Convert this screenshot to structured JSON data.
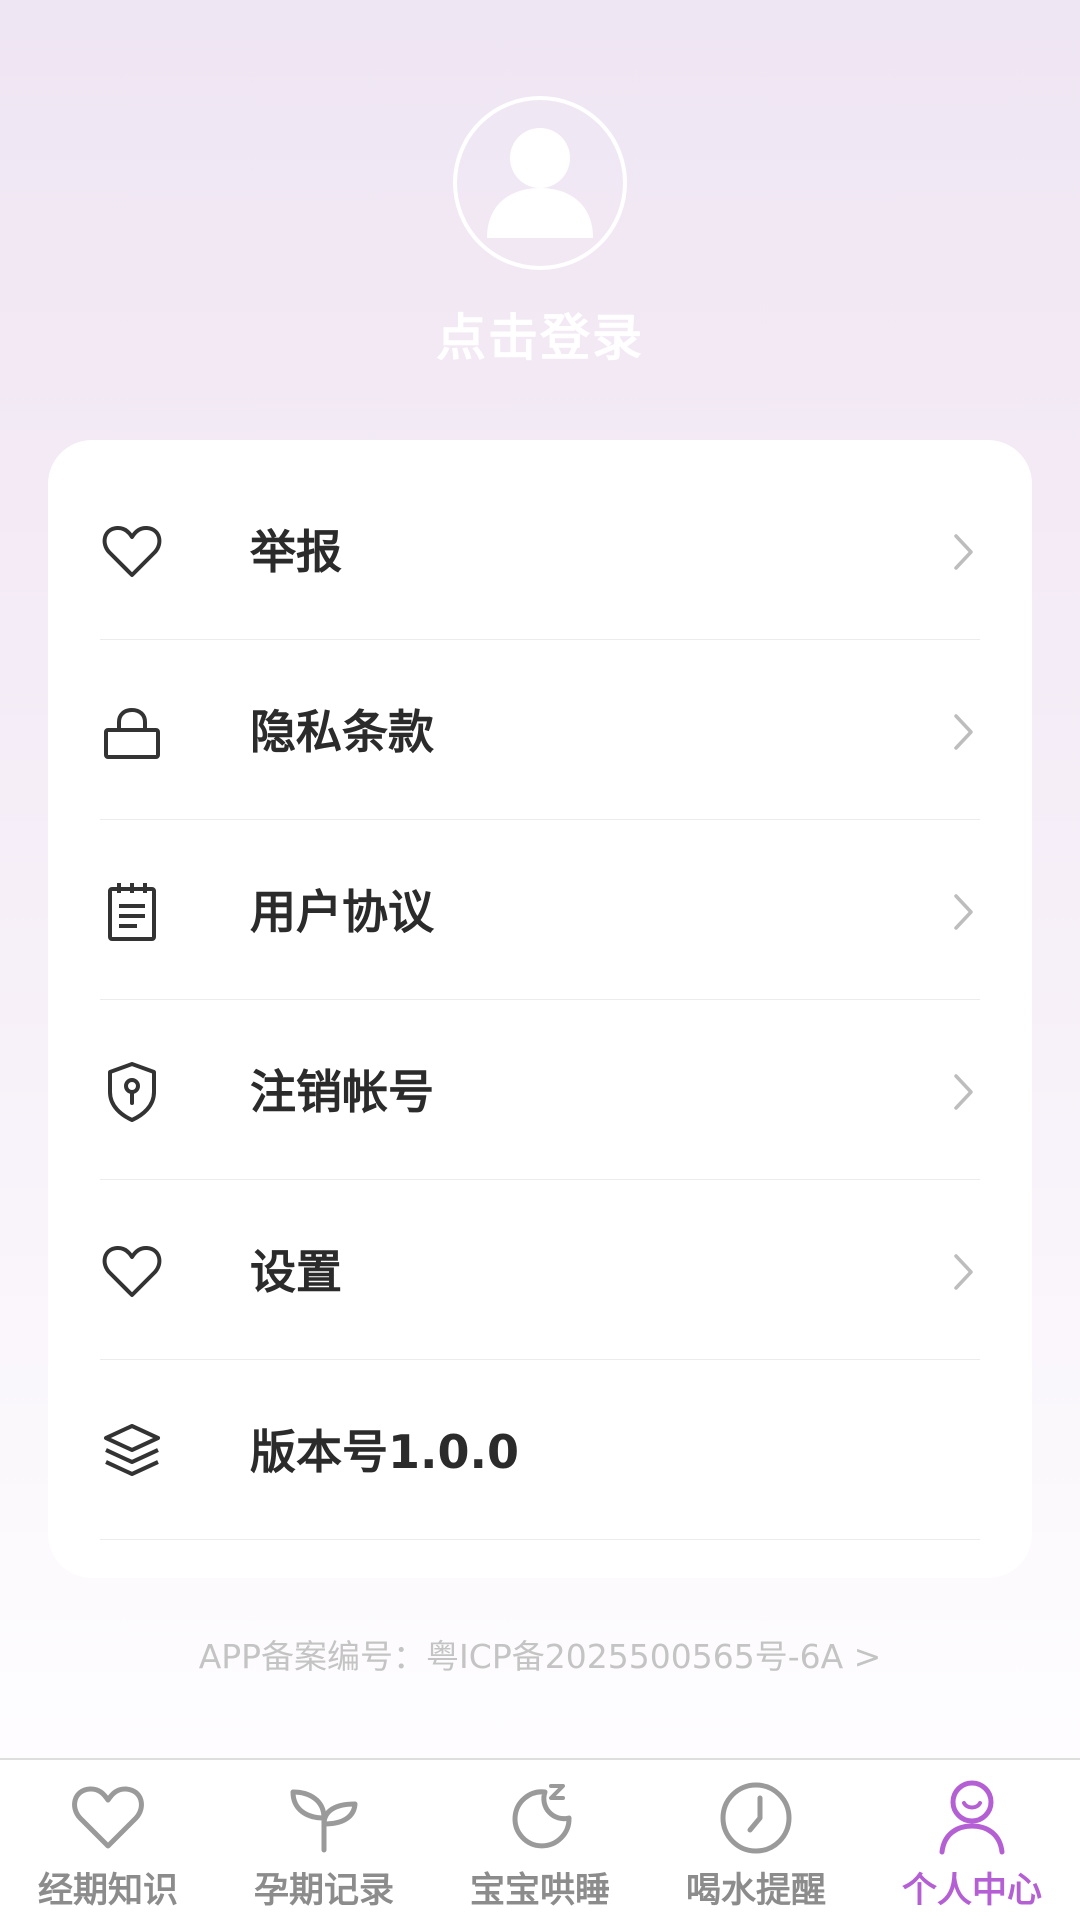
{
  "header": {
    "login_text": "点击登录",
    "avatar_icon": "user-avatar-icon"
  },
  "menu": {
    "items": [
      {
        "label": "举报",
        "icon": "heart-icon",
        "chevron": true
      },
      {
        "label": "隐私条款",
        "icon": "lock-icon",
        "chevron": true
      },
      {
        "label": "用户协议",
        "icon": "notepad-icon",
        "chevron": true
      },
      {
        "label": "注销帐号",
        "icon": "shield-keyhole-icon",
        "chevron": true
      },
      {
        "label": "设置",
        "icon": "heart-icon",
        "chevron": true
      },
      {
        "label": "版本号1.0.0",
        "icon": "layers-icon",
        "chevron": false
      }
    ]
  },
  "footer": {
    "icp": "APP备案编号：粤ICP备2025500565号-6A >"
  },
  "tabbar": {
    "tabs": [
      {
        "label": "经期知识",
        "icon": "heart-icon",
        "active": false
      },
      {
        "label": "孕期记录",
        "icon": "sprout-icon",
        "active": false
      },
      {
        "label": "宝宝哄睡",
        "icon": "moon-sleep-icon",
        "active": false
      },
      {
        "label": "喝水提醒",
        "icon": "clock-icon",
        "active": false
      },
      {
        "label": "个人中心",
        "icon": "person-icon",
        "active": true
      }
    ]
  },
  "colors": {
    "accent": "#b45fd4",
    "tab_inactive": "#8c8c8c",
    "menu_text": "#2b2b2b",
    "icp_text": "#c4c4c4",
    "background_top": "#efe6f3"
  }
}
